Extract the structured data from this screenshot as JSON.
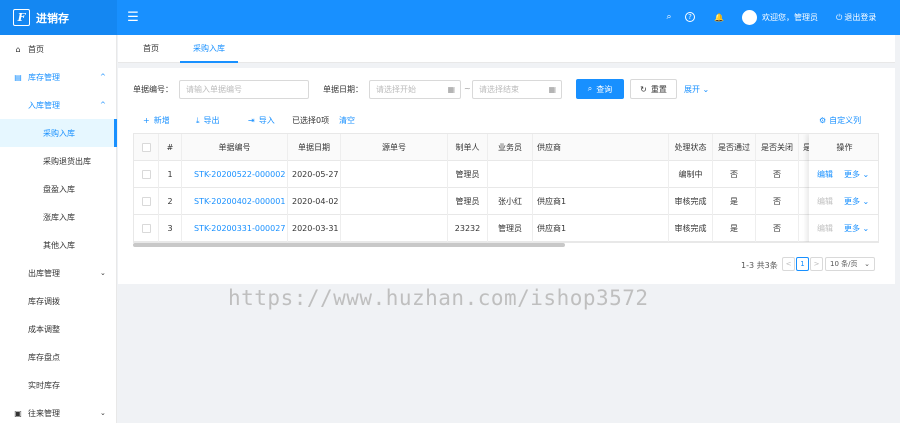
{
  "app": {
    "logo_glyph": "F",
    "title": "进销存"
  },
  "header": {
    "collapse_icon": "☰",
    "icons": [
      "⌕",
      "?",
      "🔔"
    ],
    "welcome": "欢迎您，管理员",
    "logout_icon": "⏻",
    "logout": "退出登录"
  },
  "sidebar": {
    "home": "首页",
    "inventory": "库存管理",
    "inbound": "入库管理",
    "purchase_in": "采购入库",
    "purchase_return": "采购退货出库",
    "surplus_in": "盘盈入库",
    "rise_in": "涨库入库",
    "other_in": "其他入库",
    "outbound": "出库管理",
    "transfer": "库存调拨",
    "cost_adjust": "成本调整",
    "stocktake": "库存盘点",
    "realtime": "实时库存",
    "ledger": "往来管理"
  },
  "tabs": {
    "home": "首页",
    "current": "采购入库"
  },
  "filter": {
    "order_no_label": "单据编号：",
    "order_no_placeholder": "请输入单据编号",
    "date_label": "单据日期：",
    "start_placeholder": "请选择开始",
    "tilde": "~",
    "end_placeholder": "请选择结束",
    "search": "查询",
    "reset": "重置",
    "expand": "展开"
  },
  "toolbar": {
    "add": "新增",
    "export": "导出",
    "import": "导入",
    "selected": "已选择0项",
    "clear": "清空",
    "custom_cols": "自定义列"
  },
  "table": {
    "headers": {
      "index": "#",
      "order_no": "单据编号",
      "date": "单据日期",
      "source_no": "源单号",
      "maker": "制单人",
      "salesman": "业务员",
      "supplier": "供应商",
      "status": "处理状态",
      "passed": "是否通过",
      "closed": "是否关闭",
      "more": "是",
      "ops": "操作"
    },
    "rows": [
      {
        "index": "1",
        "order_no": "STK-20200522-000002",
        "date": "2020-05-27",
        "source_no": "",
        "maker": "管理员",
        "salesman": "",
        "supplier": "",
        "status": "编制中",
        "passed": "否",
        "closed": "否",
        "edit": "编辑",
        "more": "更多"
      },
      {
        "index": "2",
        "order_no": "STK-20200402-000001",
        "date": "2020-04-02",
        "source_no": "",
        "maker": "管理员",
        "salesman": "张小红",
        "supplier": "供应商1",
        "status": "审核完成",
        "passed": "是",
        "closed": "否",
        "edit": "编辑",
        "more": "更多"
      },
      {
        "index": "3",
        "order_no": "STK-20200331-000027",
        "date": "2020-03-31",
        "source_no": "",
        "maker": "23232",
        "salesman": "管理员",
        "supplier": "供应商1",
        "status": "审核完成",
        "passed": "是",
        "closed": "否",
        "edit": "编辑",
        "more": "更多"
      }
    ]
  },
  "pagination": {
    "total": "1-3 共3条",
    "prev": "<",
    "current": "1",
    "next": ">",
    "page_size": "10 条/页"
  },
  "watermark": "https://www.huzhan.com/ishop3572"
}
